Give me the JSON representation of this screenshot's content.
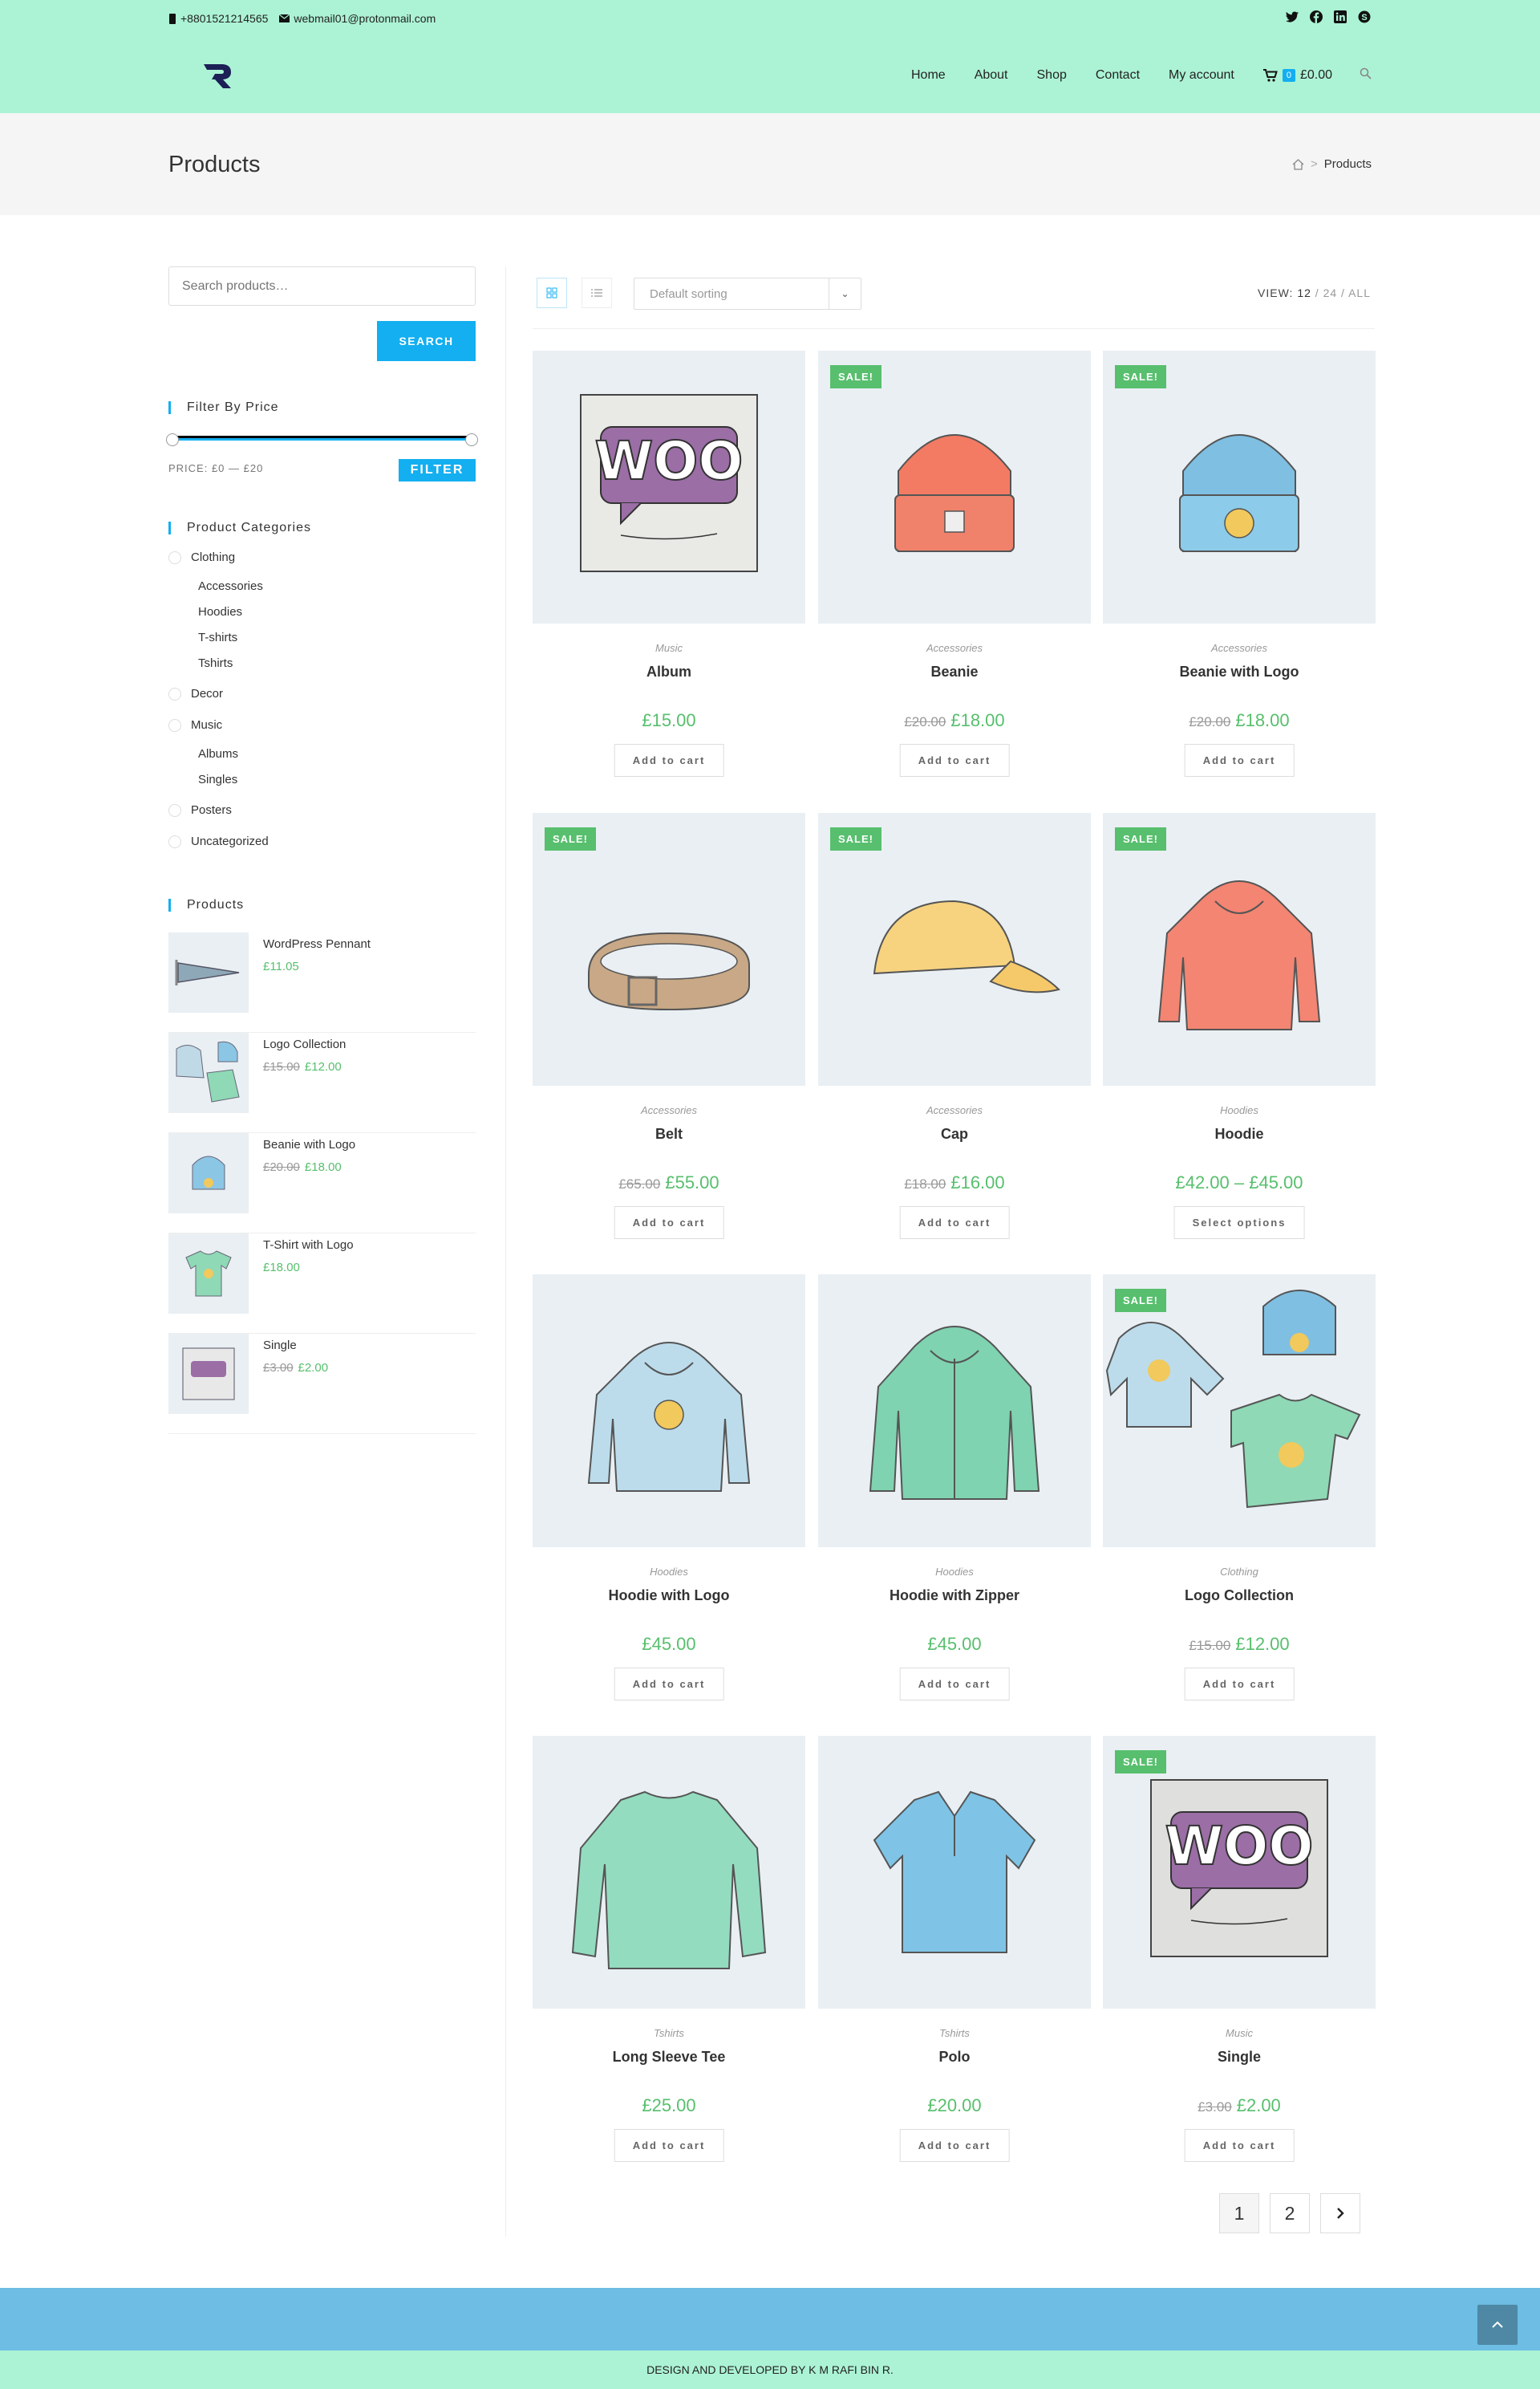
{
  "header": {
    "phone": "+8801521214565",
    "email": "webmail01@protonmail.com",
    "social": [
      "twitter-icon",
      "facebook-icon",
      "linkedin-icon",
      "skype-icon"
    ],
    "nav": [
      "Home",
      "About",
      "Shop",
      "Contact",
      "My account"
    ],
    "cart_count": "0",
    "cart_total": "£0.00"
  },
  "titlebar": {
    "title": "Products",
    "crumb": "Products"
  },
  "sidebar": {
    "search_placeholder": "Search products…",
    "search_button": "SEARCH",
    "filter_title": "Filter By Price",
    "price_label": "PRICE: £0 — £20",
    "filter_button": "FILTER",
    "categories_title": "Product Categories",
    "categories": [
      {
        "label": "Clothing",
        "children": [
          "Accessories",
          "Hoodies",
          "T-shirts",
          "Tshirts"
        ]
      },
      {
        "label": "Decor",
        "children": []
      },
      {
        "label": "Music",
        "children": [
          "Albums",
          "Singles"
        ]
      },
      {
        "label": "Posters",
        "children": []
      },
      {
        "label": "Uncategorized",
        "children": []
      }
    ],
    "products_title": "Products",
    "products": [
      {
        "name": "WordPress Pennant",
        "old": "",
        "price": "£11.05"
      },
      {
        "name": "Logo Collection",
        "old": "£15.00",
        "price": "£12.00"
      },
      {
        "name": "Beanie with Logo",
        "old": "£20.00",
        "price": "£18.00"
      },
      {
        "name": "T-Shirt with Logo",
        "old": "",
        "price": "£18.00"
      },
      {
        "name": "Single",
        "old": "£3.00",
        "price": "£2.00"
      }
    ]
  },
  "toolbar": {
    "sorting": "Default sorting",
    "view_label": "VIEW:",
    "view_options": [
      "12",
      "24",
      "ALL"
    ]
  },
  "products": [
    {
      "category": "Music",
      "title": "Album",
      "old": "",
      "price": "£15.00",
      "button": "Add to cart",
      "sale": "",
      "art": "album"
    },
    {
      "category": "Accessories",
      "title": "Beanie",
      "old": "£20.00",
      "price": "£18.00",
      "button": "Add to cart",
      "sale": "SALE!",
      "art": "beanie"
    },
    {
      "category": "Accessories",
      "title": "Beanie with Logo",
      "old": "£20.00",
      "price": "£18.00",
      "button": "Add to cart",
      "sale": "SALE!",
      "art": "beanie-logo"
    },
    {
      "category": "Accessories",
      "title": "Belt",
      "old": "£65.00",
      "price": "£55.00",
      "button": "Add to cart",
      "sale": "SALE!",
      "art": "belt"
    },
    {
      "category": "Accessories",
      "title": "Cap",
      "old": "£18.00",
      "price": "£16.00",
      "button": "Add to cart",
      "sale": "SALE!",
      "art": "cap"
    },
    {
      "category": "Hoodies",
      "title": "Hoodie",
      "old": "",
      "price": "£42.00 – £45.00",
      "button": "Select options",
      "sale": "SALE!",
      "art": "hoodie"
    },
    {
      "category": "Hoodies",
      "title": "Hoodie with Logo",
      "old": "",
      "price": "£45.00",
      "button": "Add to cart",
      "sale": "",
      "art": "hoodie-logo"
    },
    {
      "category": "Hoodies",
      "title": "Hoodie with Zipper",
      "old": "",
      "price": "£45.00",
      "button": "Add to cart",
      "sale": "",
      "art": "hoodie-zip"
    },
    {
      "category": "Clothing",
      "title": "Logo Collection",
      "old": "£15.00",
      "price": "£12.00",
      "button": "Add to cart",
      "sale": "SALE!",
      "art": "collection"
    },
    {
      "category": "Tshirts",
      "title": "Long Sleeve Tee",
      "old": "",
      "price": "£25.00",
      "button": "Add to cart",
      "sale": "",
      "art": "longsleeve"
    },
    {
      "category": "Tshirts",
      "title": "Polo",
      "old": "",
      "price": "£20.00",
      "button": "Add to cart",
      "sale": "",
      "art": "polo"
    },
    {
      "category": "Music",
      "title": "Single",
      "old": "£3.00",
      "price": "£2.00",
      "button": "Add to cart",
      "sale": "SALE!",
      "art": "single"
    }
  ],
  "pagination": [
    "1",
    "2"
  ],
  "footer": {
    "credit": "DESIGN AND DEVELOPED BY K M RAFI BIN R."
  },
  "colors": {
    "accent": "#13aff0",
    "sale": "#57bf6d",
    "header_bg": "#acf3d5",
    "footer_band": "#6dbde4"
  }
}
